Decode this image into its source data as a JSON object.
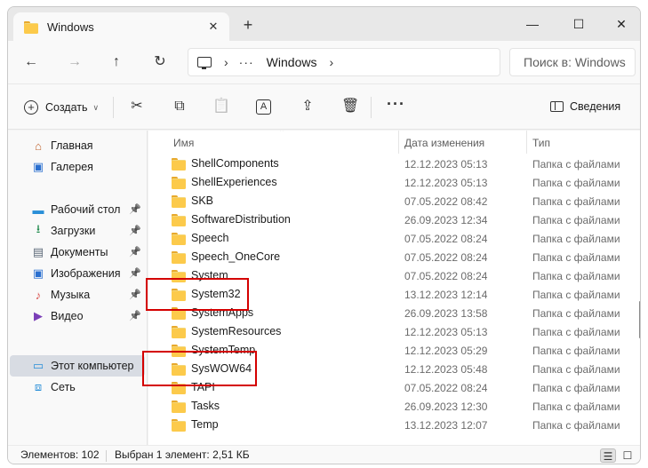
{
  "window": {
    "tab_title": "Windows",
    "tab_close": "✕",
    "new_tab": "+",
    "minimize": "—",
    "maximize": "☐",
    "close": "✕"
  },
  "nav": {
    "back": "←",
    "forward": "→",
    "up": "↑",
    "refresh": "↻",
    "address_sep": "›",
    "address_more": "···",
    "address_location": "Windows",
    "search_placeholder": "Поиск в: Windows"
  },
  "commands": {
    "create_label": "Создать",
    "create_plus": "+",
    "create_chevron": "∨",
    "cut": "✂",
    "copy": "⧉",
    "paste": "📋",
    "rename": "A",
    "share": "⇪",
    "delete": "🗑",
    "more": "···",
    "details_label": "Сведения"
  },
  "sidebar": {
    "items": [
      {
        "label": "Главная",
        "icon": "home-icon",
        "glyph": "⌂",
        "color": "#c0622d"
      },
      {
        "label": "Галерея",
        "icon": "gallery-icon",
        "glyph": "▣",
        "color": "#2a6fcf"
      },
      {
        "label": "Рабочий стол",
        "icon": "desktop-icon",
        "glyph": "▬",
        "color": "#2a8fd8",
        "pin": "📌"
      },
      {
        "label": "Загрузки",
        "icon": "downloads-icon",
        "glyph": "⭳",
        "color": "#1f8a4c",
        "pin": "📌"
      },
      {
        "label": "Документы",
        "icon": "documents-icon",
        "glyph": "▤",
        "color": "#5f6b7a",
        "pin": "📌"
      },
      {
        "label": "Изображения",
        "icon": "pictures-icon",
        "glyph": "▣",
        "color": "#2a6fcf",
        "pin": "📌"
      },
      {
        "label": "Музыка",
        "icon": "music-icon",
        "glyph": "♪",
        "color": "#d9534f",
        "pin": "📌"
      },
      {
        "label": "Видео",
        "icon": "videos-icon",
        "glyph": "▶",
        "color": "#7b3fb8",
        "pin": "📌"
      },
      {
        "label": "Этот компьютер",
        "icon": "this-pc-icon",
        "glyph": "▭",
        "color": "#2a8fd8"
      },
      {
        "label": "Сеть",
        "icon": "network-icon",
        "glyph": "⧈",
        "color": "#2a8fd8"
      }
    ]
  },
  "columns": {
    "name": "Имя",
    "date": "Дата изменения",
    "type": "Тип",
    "sort_arrow": "⌃"
  },
  "files": [
    {
      "name": "ShellComponents",
      "date": "12.12.2023 05:13",
      "type": "Папка с файлами"
    },
    {
      "name": "ShellExperiences",
      "date": "12.12.2023 05:13",
      "type": "Папка с файлами"
    },
    {
      "name": "SKB",
      "date": "07.05.2022 08:42",
      "type": "Папка с файлами"
    },
    {
      "name": "SoftwareDistribution",
      "date": "26.09.2023 12:34",
      "type": "Папка с файлами"
    },
    {
      "name": "Speech",
      "date": "07.05.2022 08:24",
      "type": "Папка с файлами"
    },
    {
      "name": "Speech_OneCore",
      "date": "07.05.2022 08:24",
      "type": "Папка с файлами"
    },
    {
      "name": "System",
      "date": "07.05.2022 08:24",
      "type": "Папка с файлами"
    },
    {
      "name": "System32",
      "date": "13.12.2023 12:14",
      "type": "Папка с файлами"
    },
    {
      "name": "SystemApps",
      "date": "26.09.2023 13:58",
      "type": "Папка с файлами"
    },
    {
      "name": "SystemResources",
      "date": "12.12.2023 05:13",
      "type": "Папка с файлами"
    },
    {
      "name": "SystemTemp",
      "date": "12.12.2023 05:29",
      "type": "Папка с файлами"
    },
    {
      "name": "SysWOW64",
      "date": "12.12.2023 05:48",
      "type": "Папка с файлами"
    },
    {
      "name": "TAPI",
      "date": "07.05.2022 08:24",
      "type": "Папка с файлами"
    },
    {
      "name": "Tasks",
      "date": "26.09.2023 12:30",
      "type": "Папка с файлами"
    },
    {
      "name": "Temp",
      "date": "13.12.2023 12:07",
      "type": "Папка с файлами"
    }
  ],
  "status": {
    "count": "Элементов: 102",
    "selection": "Выбран 1 элемент: 2,51 КБ",
    "details_view": "☰",
    "tiles_view": "☐"
  },
  "colors": {
    "highlight": "#d40000",
    "selected_nav": "#d8dce3"
  }
}
